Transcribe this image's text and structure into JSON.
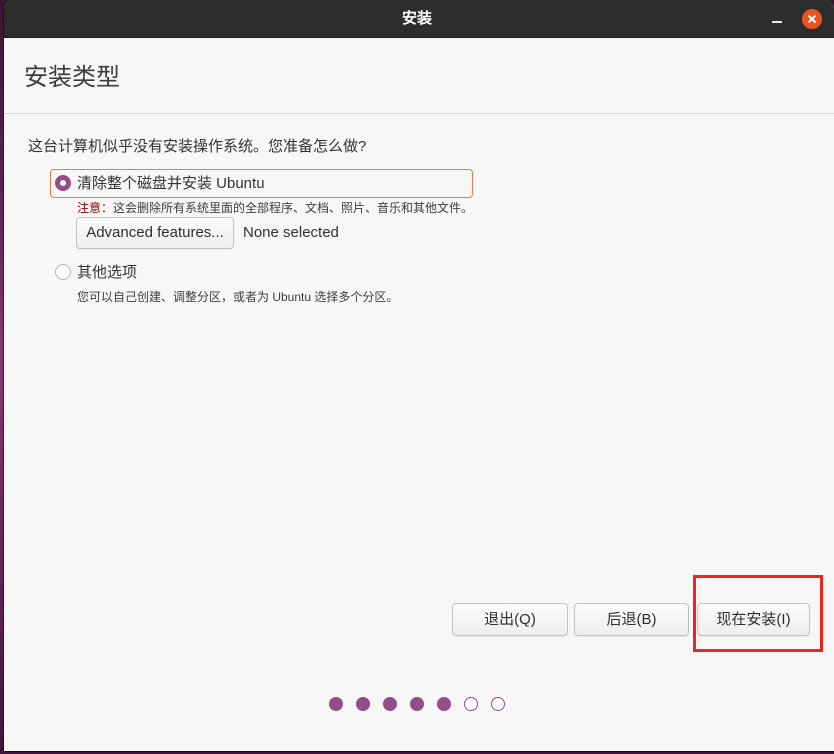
{
  "window": {
    "title": "安装",
    "minimize_icon": "minimize-icon",
    "close_icon": "close-icon"
  },
  "page": {
    "heading": "安装类型",
    "question": "这台计算机似乎没有安装操作系统。您准备怎么做?"
  },
  "options": [
    {
      "label": "清除整个磁盘并安装 Ubuntu",
      "selected": true,
      "focused": true,
      "note_prefix": "注意：",
      "note": "这会删除所有系统里面的全部程序、文档、照片、音乐和其他文件。",
      "advanced_button": "Advanced features...",
      "advanced_status": "None selected"
    },
    {
      "label": "其他选项",
      "selected": false,
      "focused": false,
      "description": "您可以自己创建、调整分区，或者为 Ubuntu 选择多个分区。"
    }
  ],
  "buttons": {
    "quit": "退出(Q)",
    "back": "后退(B)",
    "install_now": "现在安装(I)"
  },
  "progress": {
    "current_step": 5,
    "total_steps": 7
  },
  "colors": {
    "accent": "#924d8b",
    "close_button": "#e95420",
    "focus_ring": "#ec7a4e",
    "warning": "#8b0000",
    "titlebar": "#2d2d2d",
    "window_bg": "#f7f7f7",
    "highlight": "#e8271f"
  }
}
